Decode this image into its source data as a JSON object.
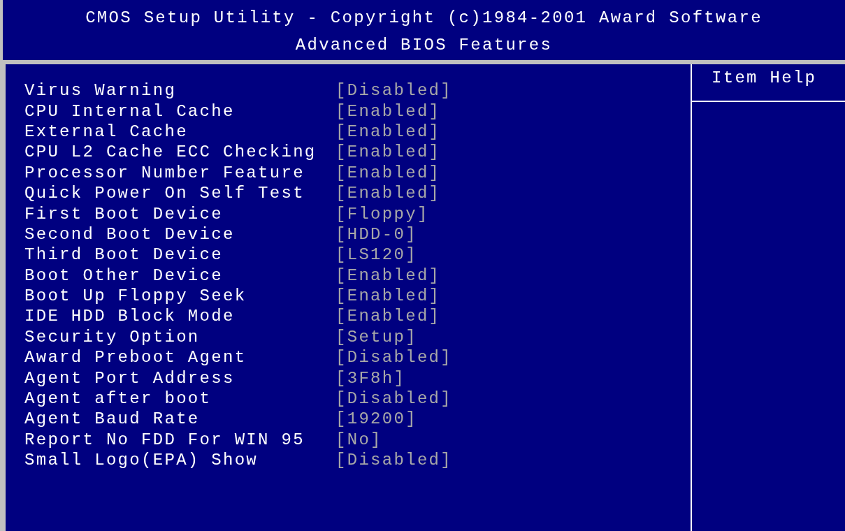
{
  "header": {
    "title": "CMOS Setup Utility - Copyright (c)1984-2001 Award Software",
    "subtitle": "Advanced BIOS Features"
  },
  "settings": [
    {
      "label": "Virus Warning",
      "value": "[Disabled]"
    },
    {
      "label": "CPU Internal Cache",
      "value": "[Enabled]"
    },
    {
      "label": "External Cache",
      "value": "[Enabled]"
    },
    {
      "label": "CPU L2 Cache ECC Checking",
      "value": "[Enabled]"
    },
    {
      "label": "Processor Number Feature",
      "value": "[Enabled]"
    },
    {
      "label": "Quick Power On Self Test",
      "value": "[Enabled]"
    },
    {
      "label": "First Boot Device",
      "value": "[Floppy]"
    },
    {
      "label": "Second Boot Device",
      "value": "[HDD-0]"
    },
    {
      "label": "Third Boot Device",
      "value": "[LS120]"
    },
    {
      "label": "Boot Other Device",
      "value": "[Enabled]"
    },
    {
      "label": "Boot Up Floppy Seek",
      "value": "[Enabled]"
    },
    {
      "label": "IDE HDD Block Mode",
      "value": "[Enabled]"
    },
    {
      "label": "Security Option",
      "value": "[Setup]"
    },
    {
      "label": "Award Preboot Agent",
      "value": "[Disabled]"
    },
    {
      "label": "Agent Port Address",
      "value": "[3F8h]"
    },
    {
      "label": "Agent after boot",
      "value": "[Disabled]"
    },
    {
      "label": "Agent Baud Rate",
      "value": "[19200]"
    },
    {
      "label": "Report No FDD For WIN 95",
      "value": "[No]"
    },
    {
      "label": "Small Logo(EPA) Show",
      "value": "[Disabled]"
    }
  ],
  "help_panel": {
    "title": "Item Help"
  }
}
